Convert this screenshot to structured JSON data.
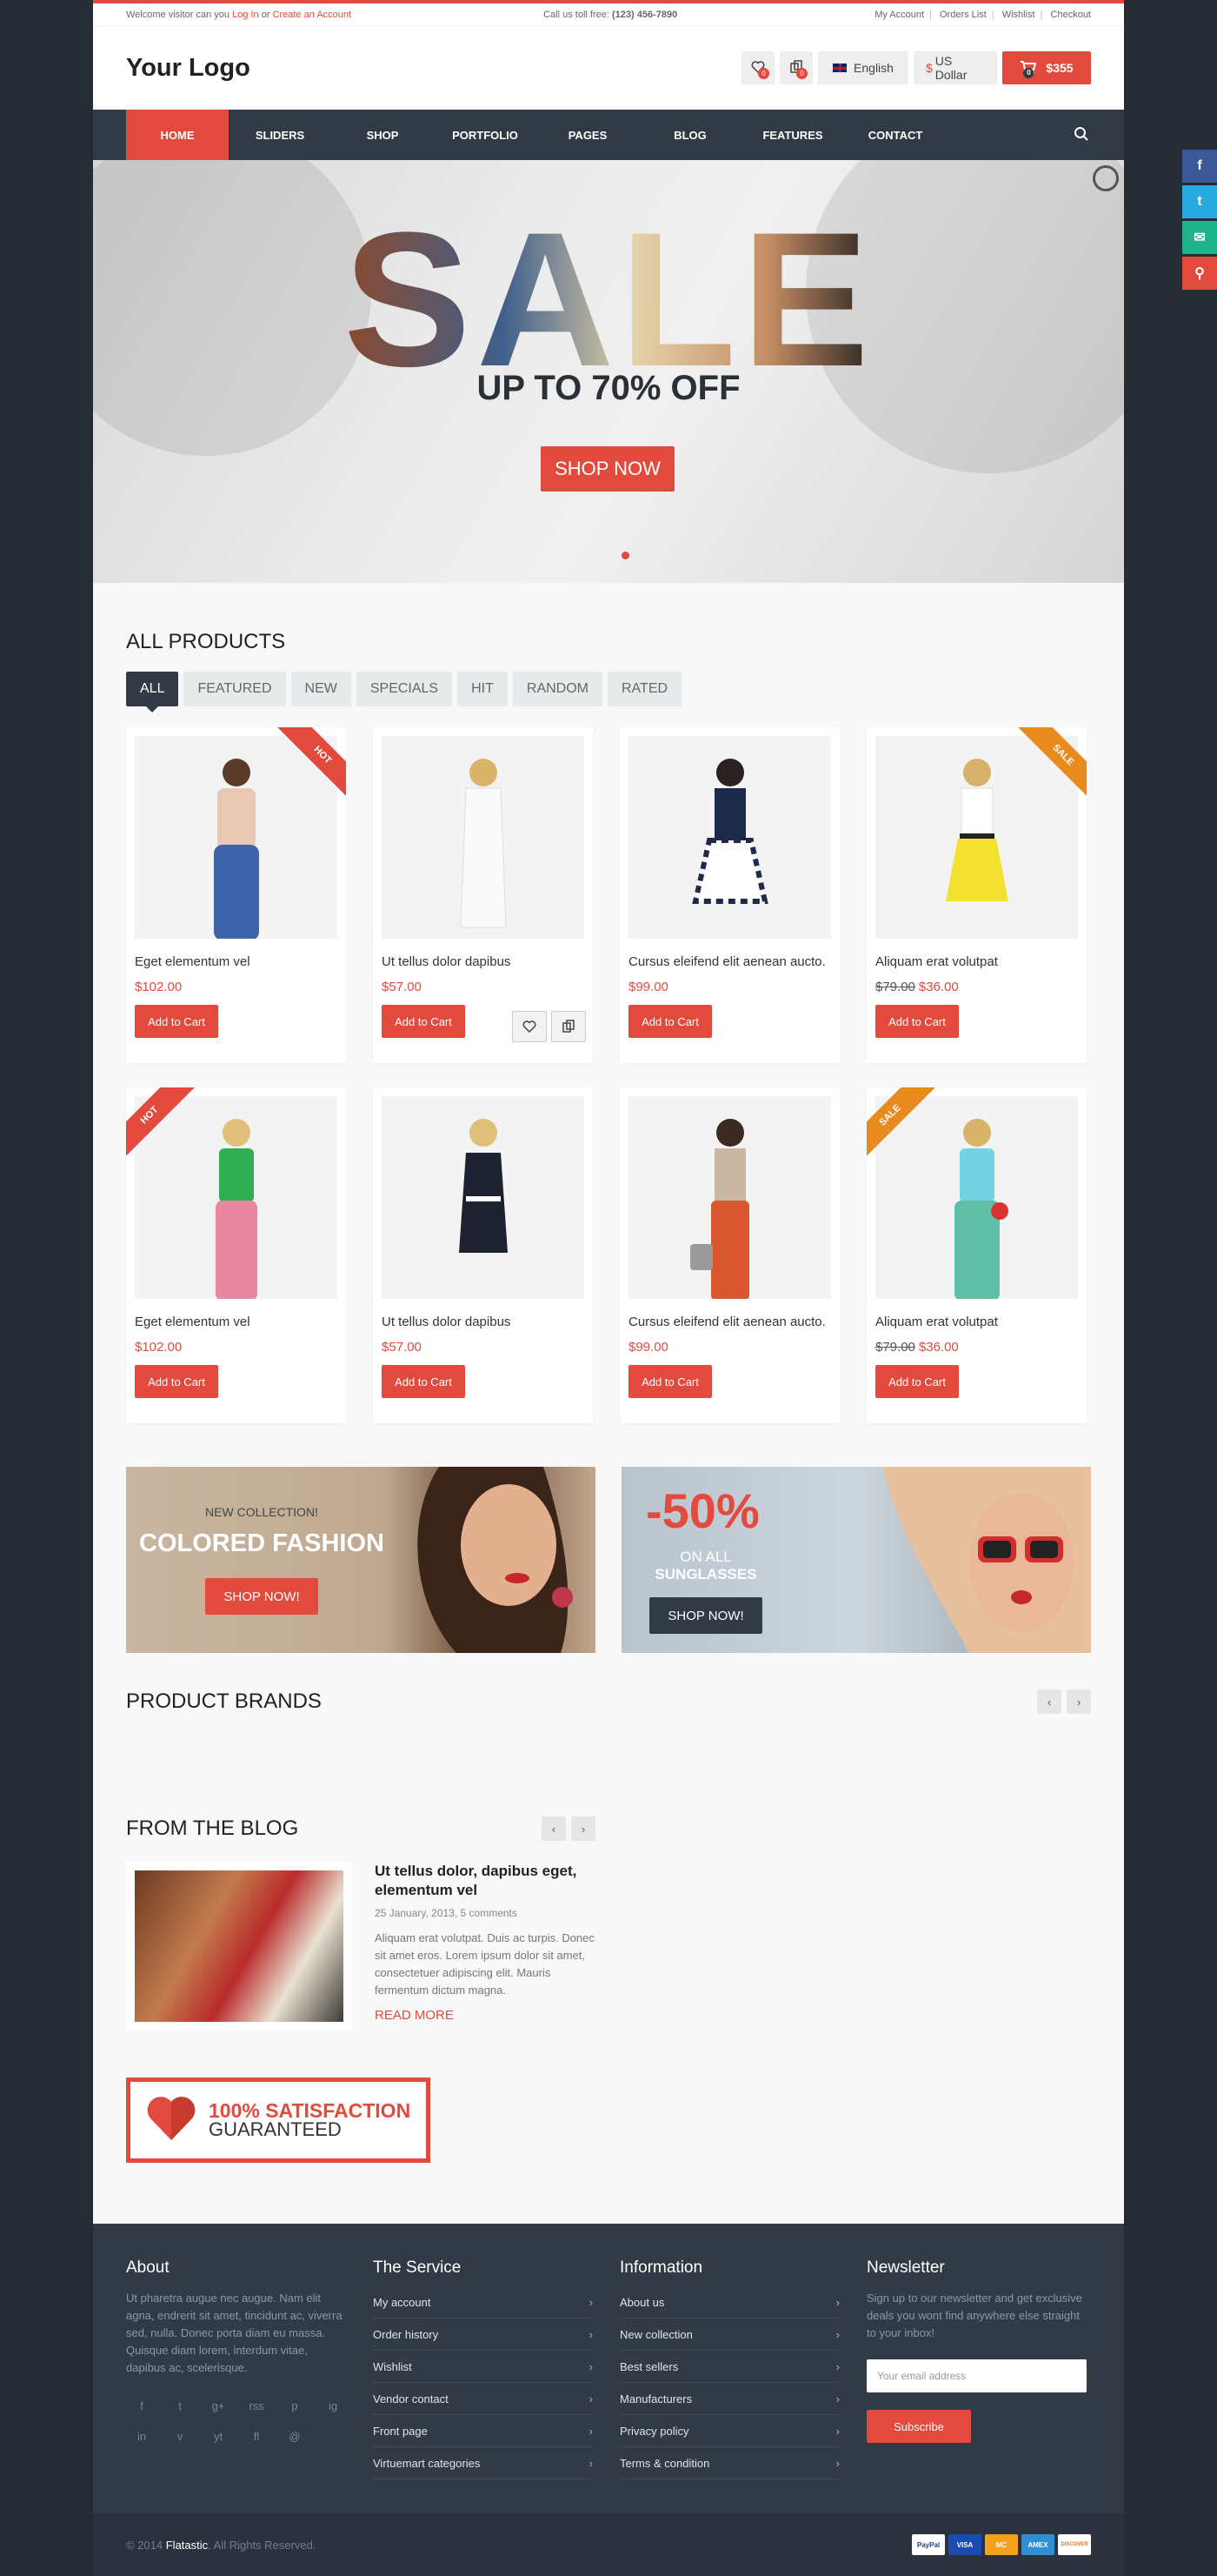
{
  "topbar": {
    "welcome": "Welcome visitor can you ",
    "login": "Log In",
    "or": " or ",
    "create": "Create an Account",
    "phone_label": "Call us toll free: ",
    "phone": "(123) 456-7890",
    "links": [
      "My Account",
      "Orders List",
      "Wishlist",
      "Checkout"
    ]
  },
  "header": {
    "logo": "Your Logo",
    "wishlist_count": "0",
    "compare_count": "0",
    "language": "English",
    "currency": "US Dollar",
    "currency_symbol": "$",
    "cart_count": "0",
    "cart_total": "$355"
  },
  "nav": {
    "items": [
      "HOME",
      "SLIDERS",
      "SHOP",
      "PORTFOLIO",
      "PAGES",
      "BLOG",
      "FEATURES",
      "CONTACT"
    ]
  },
  "hero": {
    "headline": "SALE",
    "subline": "UP TO 70% OFF",
    "button": "SHOP NOW"
  },
  "products": {
    "title": "ALL PRODUCTS",
    "filters": [
      "ALL",
      "FEATURED",
      "NEW",
      "SPECIALS",
      "HIT",
      "RANDOM",
      "RATED"
    ],
    "items": [
      {
        "name": "Eget elementum vel",
        "price": "$102.00",
        "old": "",
        "badge": "HOT",
        "button": "Add to Cart"
      },
      {
        "name": "Ut tellus dolor dapibus",
        "price": "$57.00",
        "old": "",
        "badge": "",
        "button": "Add to Cart"
      },
      {
        "name": "Cursus eleifend elit aenean aucto.",
        "price": "$99.00",
        "old": "",
        "badge": "",
        "button": "Add to Cart"
      },
      {
        "name": "Aliquam erat volutpat",
        "price": "$36.00",
        "old": "$79.00",
        "badge": "SALE",
        "button": "Add to Cart"
      },
      {
        "name": "Eget elementum vel",
        "price": "$102.00",
        "old": "",
        "badge": "HOT",
        "button": "Add to Cart"
      },
      {
        "name": "Ut tellus dolor dapibus",
        "price": "$57.00",
        "old": "",
        "badge": "",
        "button": "Add to Cart"
      },
      {
        "name": "Cursus eleifend elit aenean aucto.",
        "price": "$99.00",
        "old": "",
        "badge": "",
        "button": "Add to Cart"
      },
      {
        "name": "Aliquam erat volutpat",
        "price": "$36.00",
        "old": "$79.00",
        "badge": "SALE",
        "button": "Add to Cart"
      }
    ]
  },
  "banner1": {
    "kicker": "NEW COLLECTION!",
    "title": "COLORED FASHION",
    "button": "SHOP NOW!"
  },
  "banner2": {
    "percent": "-50%",
    "line1": "ON ALL",
    "line2": "SUNGLASSES",
    "button": "SHOP NOW!"
  },
  "brands": {
    "title": "PRODUCT BRANDS",
    "prev": "‹",
    "next": "›"
  },
  "blog": {
    "title": "FROM THE BLOG",
    "prev": "‹",
    "next": "›",
    "post": {
      "title": "Ut tellus dolor, dapibus eget, elementum vel",
      "meta": "25 January, 2013, 5 comments",
      "excerpt": "Aliquam erat volutpat. Duis ac turpis. Donec sit amet eros. Lorem ipsum dolor sit amet, consectetuer adipiscing elit. Mauris fermentum dictum magna.",
      "more": "READ MORE"
    }
  },
  "satisfaction": {
    "line1": "100% SATISFACTION",
    "line2": "GUARANTEED"
  },
  "footer": {
    "about": {
      "title": "About",
      "text": "Ut pharetra augue nec augue. Nam elit agna, endrerit sit amet, tincidunt ac, viverra sed, nulla. Donec porta diam eu massa. Quisque diam lorem, interdum vitae, dapibus ac, scelerisque."
    },
    "service": {
      "title": "The Service",
      "links": [
        "My account",
        "Order history",
        "Wishlist",
        "Vendor contact",
        "Front page",
        "Virtuemart categories"
      ]
    },
    "info": {
      "title": "Information",
      "links": [
        "About us",
        "New collection",
        "Best sellers",
        "Manufacturers",
        "Privacy policy",
        "Terms & condition"
      ]
    },
    "newsletter": {
      "title": "Newsletter",
      "text": "Sign up to our newsletter and get exclusive deals you wont find anywhere else straight to your inbox!",
      "placeholder": "Your email address",
      "button": "Subscribe"
    },
    "socials": [
      "f",
      "t",
      "g+",
      "rss",
      "p",
      "ig",
      "in",
      "v",
      "yt",
      "fl",
      "@"
    ]
  },
  "copyright": {
    "year": "© 2014 ",
    "brand": "Flatastic",
    "rest": ". All Rights Reserved.",
    "cards": [
      "PayPal",
      "VISA",
      "MC",
      "AMEX",
      "DISCOVER"
    ]
  },
  "sidebar": {
    "icons": [
      "f",
      "t",
      "✉",
      "⚲"
    ]
  },
  "colors": {
    "accent": "#e14a3c",
    "dark": "#323a46",
    "orange": "#e98a1f"
  }
}
